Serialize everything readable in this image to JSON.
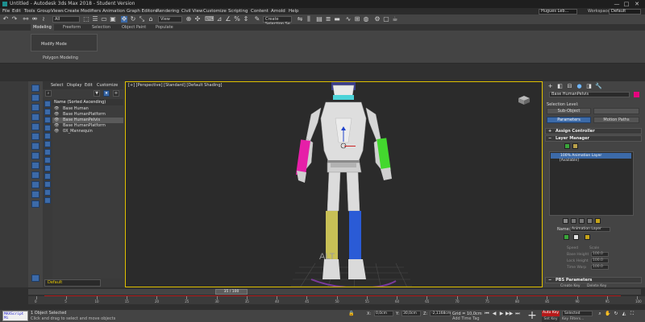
{
  "window": {
    "title": "Untitled - Autodesk 3ds Max 2018 - Student Version",
    "minimize": "—",
    "maximize": "□",
    "close": "✕"
  },
  "menubar": {
    "items": [
      "File",
      "Edit",
      "Tools",
      "Group",
      "Views",
      "Create",
      "Modifiers",
      "Animation",
      "Graph Editors",
      "Rendering",
      "Civil View",
      "Customize",
      "Scripting",
      "Content",
      "Arnold",
      "Help"
    ],
    "user": "Hugues Leb...",
    "workspaces_label": "Workspaces:",
    "workspace": "Default"
  },
  "toolbar": {
    "filter": "All",
    "view": "View",
    "named_selection": "Create Selection Se"
  },
  "ribbon": {
    "tabs": [
      "Modeling",
      "Freeform",
      "Selection",
      "Object Paint",
      "Populate"
    ],
    "modify_mode": "Modify Mode",
    "panel_label": "Polygon Modeling"
  },
  "explorer": {
    "tabs": [
      "Select",
      "Display",
      "Edit",
      "Customize"
    ],
    "header": "Name (Sorted Ascending)",
    "rows": [
      "Base Human",
      "Base HumanPlatform",
      "Base HumanPelvis",
      "Base HumanPlatform",
      "0X_Mannequin"
    ],
    "selected_index": 2,
    "layer": "Default"
  },
  "viewport": {
    "label": "[+] [Perspective] [Standard] [Default Shading]",
    "overlay_text": "ALT"
  },
  "command_panel": {
    "object_name": "Base HumanPelvis",
    "selection_level": "Selection Level:",
    "sub_object": "Sub-Object",
    "parameters": "Parameters",
    "motion_paths": "Motion Paths",
    "assign_controller": "Assign Controller",
    "layer_manager": "Layer Manager",
    "layer_item": "100% Animation Layer",
    "layer_avail": "[Available]",
    "name_label": "Name:",
    "name_value": "Animation Layer",
    "speed": "Speed",
    "scale": "Scale",
    "scale_value": "100.0",
    "base_height": "Base Height",
    "base_height_value": "100.0",
    "lock_height": "Lock Height",
    "lock_height_value": "100.0",
    "time_warp": "Time Warp",
    "time_warp_value": "100.0",
    "pbs_parameters": "PBS Parameters",
    "create_key": "Create Key",
    "delete_key": "Delete Key"
  },
  "timeline": {
    "position": "35 / 100",
    "ticks": [
      "0",
      "5",
      "10",
      "15",
      "20",
      "25",
      "30",
      "35",
      "40",
      "45",
      "50",
      "55",
      "60",
      "65",
      "70",
      "75",
      "80",
      "85",
      "90",
      "95",
      "100"
    ]
  },
  "statusbar": {
    "maxscript": "MAXScript Mi",
    "objects_selected": "1 Object Selected",
    "prompt": "Click and drag to select and move objects",
    "x_label": "X:",
    "x_value": "0,0cm",
    "y_label": "Y:",
    "y_value": "30,0cm",
    "z_label": "Z:",
    "z_value": "-2,1168cm",
    "grid_label": "Grid = 10,0cm",
    "add_time_tag": "Add Time Tag",
    "auto_key": "Auto Key",
    "set_key": "Set Key",
    "selection_filter": "Selected",
    "key_filters": "Key Filters..."
  },
  "colors": {
    "accent_blue": "#3c6aa8",
    "viewport_border": "#e0c000",
    "auto_key_red": "#b61a1a",
    "object_color": "#e6007e"
  }
}
